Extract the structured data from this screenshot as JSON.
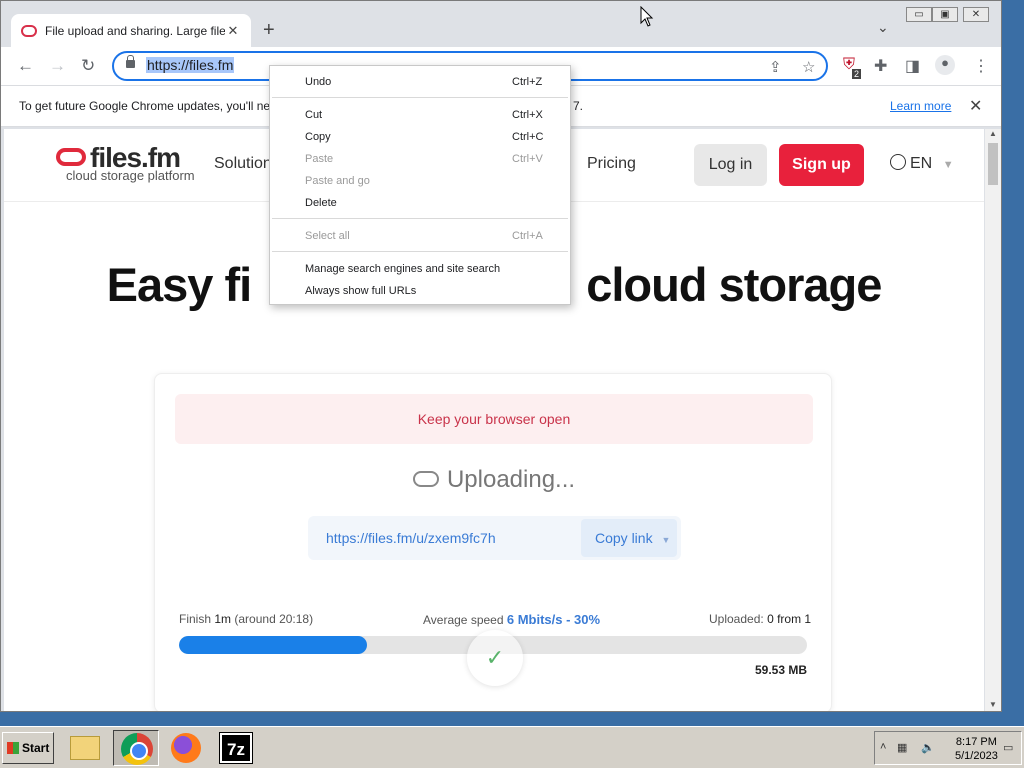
{
  "browser": {
    "tab_title": "File upload and sharing. Large file tr",
    "new_tab": "+",
    "tab_close": "✕",
    "tab_dropdown": "⌄",
    "window_controls": {
      "minimize": "▭",
      "maximize": "▣",
      "close": "✕"
    },
    "url": "https://files.fm",
    "infobar": {
      "message_left": "To get future Google Chrome updates, you'll ne",
      "message_right": "7.",
      "learn_more": "Learn more",
      "close": "✕"
    },
    "extension_badge": "2"
  },
  "context_menu": {
    "items": [
      {
        "label": "Undo",
        "shortcut": "Ctrl+Z",
        "disabled": false
      },
      {
        "label": "Cut",
        "shortcut": "Ctrl+X",
        "disabled": false
      },
      {
        "label": "Copy",
        "shortcut": "Ctrl+C",
        "disabled": false
      },
      {
        "label": "Paste",
        "shortcut": "Ctrl+V",
        "disabled": true
      },
      {
        "label": "Paste and go",
        "shortcut": "",
        "disabled": true
      },
      {
        "label": "Delete",
        "shortcut": "",
        "disabled": false
      },
      {
        "label": "Select all",
        "shortcut": "Ctrl+A",
        "disabled": true
      },
      {
        "label": "Manage search engines and site search",
        "shortcut": "",
        "disabled": false
      },
      {
        "label": "Always show full URLs",
        "shortcut": "",
        "disabled": false
      }
    ]
  },
  "site": {
    "logo_name": "files.fm",
    "logo_tagline": "cloud storage platform",
    "nav_solutions": "Solution",
    "nav_pricing": "Pricing",
    "login": "Log in",
    "signup": "Sign up",
    "lang": "EN",
    "hero_left": "Easy fi",
    "hero_right": "cloud storage",
    "alert": "Keep your browser open",
    "uploading": "Uploading...",
    "share_link": "https://files.fm/u/zxem9fc7h",
    "copy_link": "Copy link",
    "finish_label": "Finish",
    "finish_value": "1m",
    "finish_extra": "(around 20:18)",
    "speed_label": "Average speed",
    "speed_value": "6 Mbits/s - 30%",
    "uploaded_label": "Uploaded:",
    "uploaded_value": "0 from 1",
    "progress_fraction": 0.3,
    "size": "59.53 MB"
  },
  "taskbar": {
    "start": "Start",
    "time": "8:17 PM",
    "date": "5/1/2023",
    "apps": [
      "folder-icon",
      "chrome-icon",
      "firefox-icon",
      "7zip-icon"
    ]
  }
}
